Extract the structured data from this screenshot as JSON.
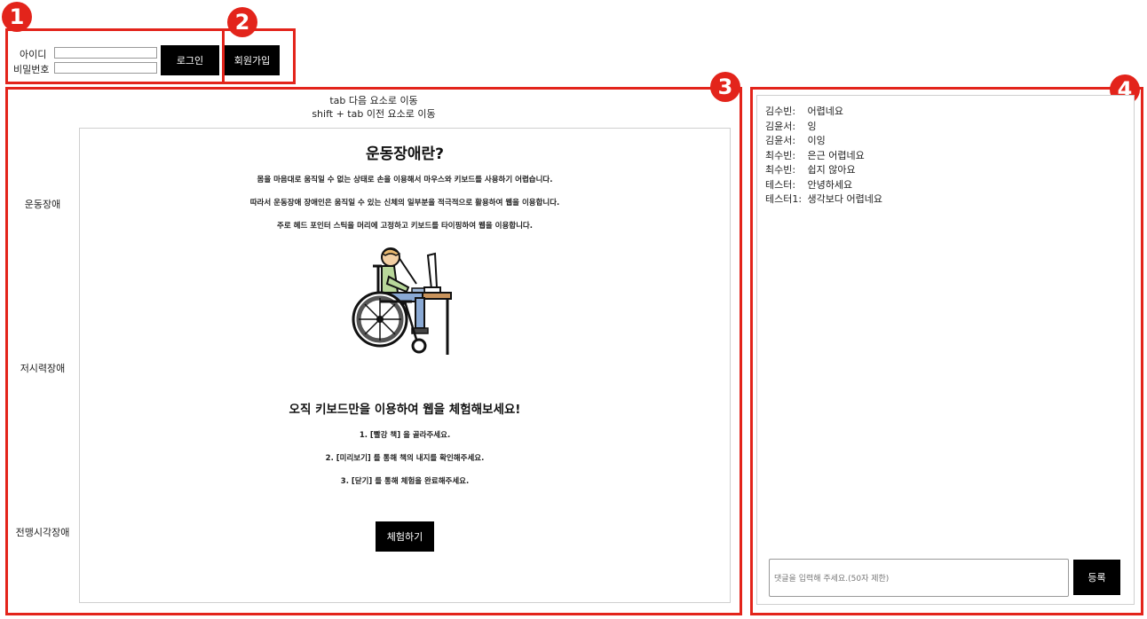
{
  "login": {
    "id_label": "아이디",
    "pw_label": "비밀번호",
    "login_button": "로그인",
    "signup_button": "회원가입"
  },
  "badges": [
    "1",
    "2",
    "3",
    "4"
  ],
  "hints": {
    "next": "tab 다음 요소로 이동",
    "prev": "shift + tab 이전 요소로 이동"
  },
  "categories": [
    "운동장애",
    "저시력장애",
    "전맹시각장애"
  ],
  "content": {
    "title": "운동장애란?",
    "paragraphs": [
      "몸을 마음대로 움직일 수 없는 상태로 손을 이용해서 마우스와 키보드를 사용하기 어렵습니다.",
      "따라서 운동장애 장애인은 움직일 수 있는 신체의 일부분을 적극적으로 활용하여 웹을 이용합니다.",
      "주로 헤드 포인터 스틱을 머리에 고정하고 키보드를 타이핑하여 웹을 이용합니다."
    ],
    "subtitle": "오직 키보드만을 이용하여 웹을 체험해보세요!",
    "steps": [
      "1. [빨강 책] 을 골라주세요.",
      "2. [미리보기] 를 통해 책의 내지를 확인해주세요.",
      "3. [닫기] 를 통해 체험을 완료해주세요."
    ],
    "try_button": "체험하기"
  },
  "chat": {
    "messages": [
      {
        "user": "김수빈:",
        "text": "어렵네요"
      },
      {
        "user": "김윤서:",
        "text": "잉"
      },
      {
        "user": "김윤서:",
        "text": "이잉"
      },
      {
        "user": "최수빈:",
        "text": "은근 어렵네요"
      },
      {
        "user": "최수빈:",
        "text": "쉽지 않아요"
      },
      {
        "user": "테스터:",
        "text": "안녕하세요"
      },
      {
        "user": "테스터1:",
        "text": "생각보다 어렵네요"
      }
    ],
    "placeholder": "댓글을 입력해 주세요.(50자 제한)",
    "submit_button": "등록"
  },
  "colors": {
    "annotation_red": "#e3241b",
    "button_black": "#000000"
  },
  "icons": [
    "wheelchair-user-illustration"
  ]
}
